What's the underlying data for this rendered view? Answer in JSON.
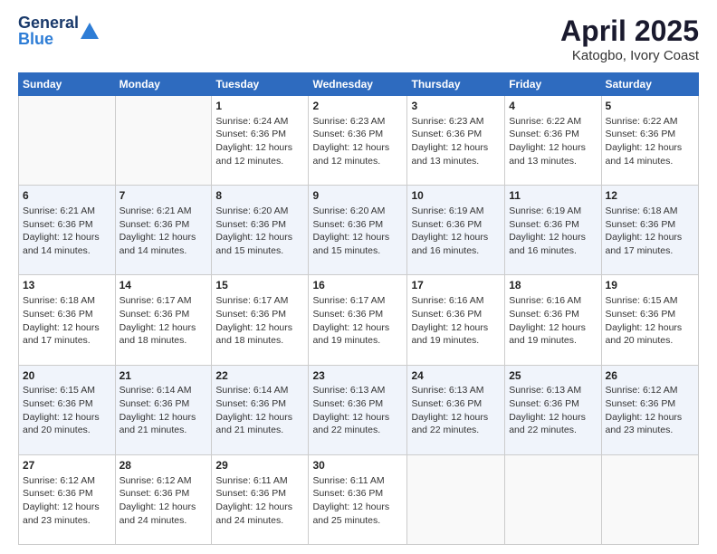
{
  "logo": {
    "line1": "General",
    "line2": "Blue"
  },
  "title": "April 2025",
  "location": "Katogbo, Ivory Coast",
  "days_header": [
    "Sunday",
    "Monday",
    "Tuesday",
    "Wednesday",
    "Thursday",
    "Friday",
    "Saturday"
  ],
  "weeks": [
    [
      {
        "num": "",
        "info": ""
      },
      {
        "num": "",
        "info": ""
      },
      {
        "num": "1",
        "info": "Sunrise: 6:24 AM\nSunset: 6:36 PM\nDaylight: 12 hours and 12 minutes."
      },
      {
        "num": "2",
        "info": "Sunrise: 6:23 AM\nSunset: 6:36 PM\nDaylight: 12 hours and 12 minutes."
      },
      {
        "num": "3",
        "info": "Sunrise: 6:23 AM\nSunset: 6:36 PM\nDaylight: 12 hours and 13 minutes."
      },
      {
        "num": "4",
        "info": "Sunrise: 6:22 AM\nSunset: 6:36 PM\nDaylight: 12 hours and 13 minutes."
      },
      {
        "num": "5",
        "info": "Sunrise: 6:22 AM\nSunset: 6:36 PM\nDaylight: 12 hours and 14 minutes."
      }
    ],
    [
      {
        "num": "6",
        "info": "Sunrise: 6:21 AM\nSunset: 6:36 PM\nDaylight: 12 hours and 14 minutes."
      },
      {
        "num": "7",
        "info": "Sunrise: 6:21 AM\nSunset: 6:36 PM\nDaylight: 12 hours and 14 minutes."
      },
      {
        "num": "8",
        "info": "Sunrise: 6:20 AM\nSunset: 6:36 PM\nDaylight: 12 hours and 15 minutes."
      },
      {
        "num": "9",
        "info": "Sunrise: 6:20 AM\nSunset: 6:36 PM\nDaylight: 12 hours and 15 minutes."
      },
      {
        "num": "10",
        "info": "Sunrise: 6:19 AM\nSunset: 6:36 PM\nDaylight: 12 hours and 16 minutes."
      },
      {
        "num": "11",
        "info": "Sunrise: 6:19 AM\nSunset: 6:36 PM\nDaylight: 12 hours and 16 minutes."
      },
      {
        "num": "12",
        "info": "Sunrise: 6:18 AM\nSunset: 6:36 PM\nDaylight: 12 hours and 17 minutes."
      }
    ],
    [
      {
        "num": "13",
        "info": "Sunrise: 6:18 AM\nSunset: 6:36 PM\nDaylight: 12 hours and 17 minutes."
      },
      {
        "num": "14",
        "info": "Sunrise: 6:17 AM\nSunset: 6:36 PM\nDaylight: 12 hours and 18 minutes."
      },
      {
        "num": "15",
        "info": "Sunrise: 6:17 AM\nSunset: 6:36 PM\nDaylight: 12 hours and 18 minutes."
      },
      {
        "num": "16",
        "info": "Sunrise: 6:17 AM\nSunset: 6:36 PM\nDaylight: 12 hours and 19 minutes."
      },
      {
        "num": "17",
        "info": "Sunrise: 6:16 AM\nSunset: 6:36 PM\nDaylight: 12 hours and 19 minutes."
      },
      {
        "num": "18",
        "info": "Sunrise: 6:16 AM\nSunset: 6:36 PM\nDaylight: 12 hours and 19 minutes."
      },
      {
        "num": "19",
        "info": "Sunrise: 6:15 AM\nSunset: 6:36 PM\nDaylight: 12 hours and 20 minutes."
      }
    ],
    [
      {
        "num": "20",
        "info": "Sunrise: 6:15 AM\nSunset: 6:36 PM\nDaylight: 12 hours and 20 minutes."
      },
      {
        "num": "21",
        "info": "Sunrise: 6:14 AM\nSunset: 6:36 PM\nDaylight: 12 hours and 21 minutes."
      },
      {
        "num": "22",
        "info": "Sunrise: 6:14 AM\nSunset: 6:36 PM\nDaylight: 12 hours and 21 minutes."
      },
      {
        "num": "23",
        "info": "Sunrise: 6:13 AM\nSunset: 6:36 PM\nDaylight: 12 hours and 22 minutes."
      },
      {
        "num": "24",
        "info": "Sunrise: 6:13 AM\nSunset: 6:36 PM\nDaylight: 12 hours and 22 minutes."
      },
      {
        "num": "25",
        "info": "Sunrise: 6:13 AM\nSunset: 6:36 PM\nDaylight: 12 hours and 22 minutes."
      },
      {
        "num": "26",
        "info": "Sunrise: 6:12 AM\nSunset: 6:36 PM\nDaylight: 12 hours and 23 minutes."
      }
    ],
    [
      {
        "num": "27",
        "info": "Sunrise: 6:12 AM\nSunset: 6:36 PM\nDaylight: 12 hours and 23 minutes."
      },
      {
        "num": "28",
        "info": "Sunrise: 6:12 AM\nSunset: 6:36 PM\nDaylight: 12 hours and 24 minutes."
      },
      {
        "num": "29",
        "info": "Sunrise: 6:11 AM\nSunset: 6:36 PM\nDaylight: 12 hours and 24 minutes."
      },
      {
        "num": "30",
        "info": "Sunrise: 6:11 AM\nSunset: 6:36 PM\nDaylight: 12 hours and 25 minutes."
      },
      {
        "num": "",
        "info": ""
      },
      {
        "num": "",
        "info": ""
      },
      {
        "num": "",
        "info": ""
      }
    ]
  ]
}
